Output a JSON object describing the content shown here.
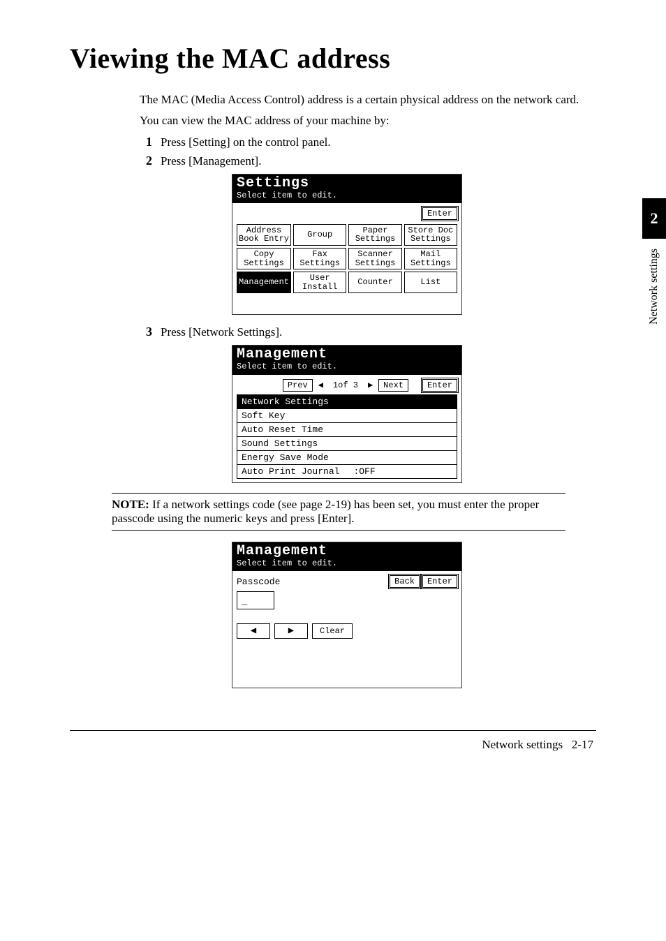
{
  "title": "Viewing the MAC address",
  "intro": {
    "p1": "The MAC (Media Access Control) address is a certain physical address on the network card.",
    "p2": "You can view the MAC address of your machine by:"
  },
  "steps": {
    "s1": {
      "num": "1",
      "text": "Press [Setting] on the control panel."
    },
    "s2": {
      "num": "2",
      "text": "Press [Management]."
    },
    "s3": {
      "num": "3",
      "text": "Press [Network Settings]."
    }
  },
  "lcd1": {
    "title": "Settings",
    "subtitle": "Select item to edit.",
    "enter": "Enter",
    "buttons": [
      "Address\nBook Entry",
      "Group",
      "Paper\nSettings",
      "Store Doc\nSettings",
      "Copy\nSettings",
      "Fax\nSettings",
      "Scanner\nSettings",
      "Mail\nSettings",
      "Management",
      "User\nInstall",
      "Counter",
      "List"
    ],
    "selected_index": 8
  },
  "lcd2": {
    "title": "Management",
    "subtitle": "Select item to edit.",
    "prev": "Prev",
    "next": "Next",
    "page_info": "1of 3",
    "enter": "Enter",
    "items": [
      {
        "label": "Network Settings",
        "value": "",
        "selected": true
      },
      {
        "label": "Soft Key",
        "value": "",
        "selected": false
      },
      {
        "label": "Auto Reset Time",
        "value": "",
        "selected": false
      },
      {
        "label": "Sound Settings",
        "value": "",
        "selected": false
      },
      {
        "label": "Energy Save Mode",
        "value": "",
        "selected": false
      },
      {
        "label": "Auto Print Journal",
        "value": ":OFF",
        "selected": false
      }
    ]
  },
  "note": {
    "label": "NOTE:",
    "text": " If a network settings code (see page 2-19) has been set, you must enter the proper passcode using the numeric keys and press [Enter]."
  },
  "lcd3": {
    "title": "Management",
    "subtitle": "Select item to edit.",
    "field_label": "Passcode",
    "back": "Back",
    "enter": "Enter",
    "input_value": "_",
    "clear": "Clear",
    "left_arrow": "◀",
    "right_arrow": "▶"
  },
  "sidetab": {
    "num": "2",
    "label": "Network settings"
  },
  "footer": {
    "section": "Network settings",
    "page": "2-17"
  }
}
